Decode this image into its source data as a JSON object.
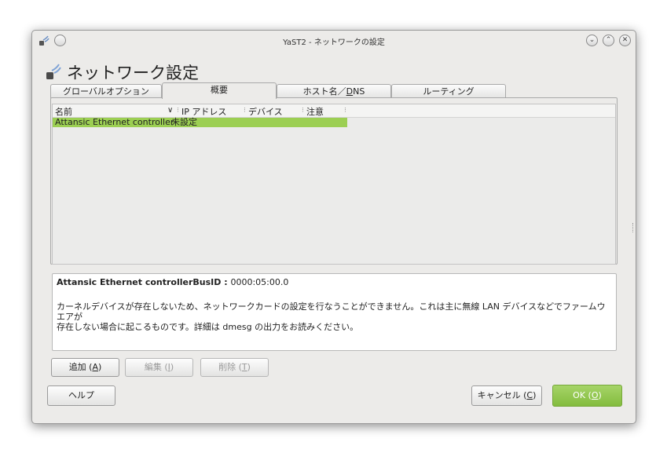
{
  "window": {
    "title": "YaST2 - ネットワークの設定",
    "heading": "ネットワーク設定"
  },
  "tabs": [
    {
      "label": "グローバルオプション",
      "active": false
    },
    {
      "label": "概要",
      "active": true
    },
    {
      "label": "ホスト名／",
      "accel": "D",
      "rest": "NS",
      "active": false
    },
    {
      "label": "ルーティング",
      "active": false
    }
  ],
  "table": {
    "columns": [
      "名前",
      "IP アドレス",
      "デバイス",
      "注意"
    ],
    "sort_indicator": "∨",
    "rows": [
      {
        "name": "Attansic Ethernet controller",
        "ip": "未設定",
        "device": "",
        "note": "",
        "selected": true
      }
    ]
  },
  "info": {
    "title": "Attansic Ethernet controller",
    "busid_label": "BusID : ",
    "busid_value": "0000:05:00.0",
    "line1": "カーネルデバイスが存在しないため、ネットワークカードの設定を行なうことができません。これは主に無線 LAN デバイスなどでファームウエアが",
    "line2": "存在しない場合に起こるものです。詳細は dmesg の出力をお読みください。"
  },
  "buttons": {
    "add": {
      "label": "追加 (",
      "accel": "A",
      "close": ")"
    },
    "edit": {
      "label": "編集 (",
      "accel": "I",
      "close": ")"
    },
    "delete": {
      "label": "削除 (",
      "accel": "T",
      "close": ")"
    },
    "help": {
      "label": "ヘルプ"
    },
    "cancel": {
      "label": "キャンセル (",
      "accel": "C",
      "close": ")"
    },
    "ok": {
      "label": "OK (",
      "accel": "O",
      "close": ")"
    }
  },
  "colors": {
    "selection": "#9ccf53",
    "ok_button": "#8ec64a",
    "window_bg": "#ecebe9"
  },
  "icons": {
    "title": "network-icon",
    "heading": "network-icon",
    "window_controls": [
      "minimize-icon",
      "maximize-icon",
      "close-icon"
    ]
  }
}
